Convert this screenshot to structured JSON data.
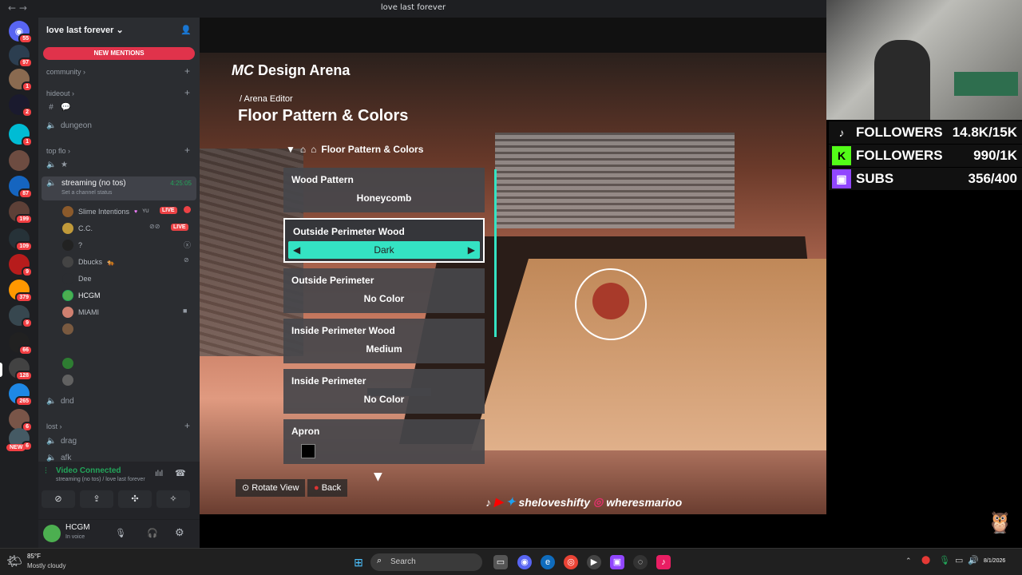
{
  "window": {
    "title": "love last forever",
    "nav": "← →"
  },
  "servers": {
    "badges": [
      "55",
      "97",
      "1",
      "2",
      "1",
      "87",
      "199",
      "109",
      "9",
      "379",
      "9",
      "66",
      "128",
      "265",
      "6",
      "6"
    ],
    "new_label": "NEW"
  },
  "sidebar": {
    "server_name": "love last forever",
    "new_mentions": "NEW MENTIONS",
    "categories": [
      "community",
      "hideout",
      "top flo",
      "lost"
    ],
    "channels": {
      "dungeon": "dungeon",
      "streaming": "streaming (no tos)",
      "streaming_time": "4:25:05",
      "set_status": "Set a channel status",
      "dnd": "dnd",
      "drag": "drag",
      "afk": "afk"
    },
    "users": [
      {
        "name": "Slime Intentions",
        "extra": "YU",
        "live": "LIVE",
        "color": "#8b5a2b"
      },
      {
        "name": "C.C.",
        "live": "LIVE",
        "color": "#c19a3a"
      },
      {
        "name": "?",
        "color": "#222222"
      },
      {
        "name": "Dbucks",
        "color": "#444444"
      },
      {
        "name": "Dee",
        "color": "#2b2d31"
      },
      {
        "name": "HCGM",
        "color": "#4caf50"
      },
      {
        "name": "MIAMI",
        "color": "#d08070"
      }
    ]
  },
  "voice": {
    "status": "Video Connected",
    "location": "streaming (no tos) / love last forever",
    "user": "HCGM",
    "user_status": "In voice"
  },
  "game": {
    "brand": "Design Arena",
    "breadcrumb": "/ Arena Editor",
    "heading": "Floor Pattern & Colors",
    "panel_title": "Floor Pattern & Colors",
    "rows": [
      {
        "label": "Wood Pattern",
        "value": "Honeycomb"
      },
      {
        "label": "Outside Perimeter Wood",
        "value": "Dark"
      },
      {
        "label": "Outside Perimeter",
        "value": "No Color"
      },
      {
        "label": "Inside Perimeter Wood",
        "value": "Medium"
      },
      {
        "label": "Inside Perimeter",
        "value": "No Color"
      },
      {
        "label": "Apron",
        "value": ""
      }
    ],
    "hints": {
      "rotate": "Rotate View",
      "back": "Back"
    },
    "socials": "sheloveshifty",
    "socials2": "wheresmarioo"
  },
  "stream_overlay": [
    {
      "label": "FOLLOWERS",
      "value": "14.8K/15K",
      "icon": "tiktok-icon",
      "color": "#111111"
    },
    {
      "label": "FOLLOWERS",
      "value": "990/1K",
      "icon": "kick-icon",
      "color": "#53fc18"
    },
    {
      "label": "SUBS",
      "value": "356/400",
      "icon": "twitch-icon",
      "color": "#9146ff"
    }
  ],
  "taskbar": {
    "weather_temp": "85°F",
    "weather_desc": "Mostly cloudy",
    "search_placeholder": "Search",
    "date": "8/1/2026"
  }
}
